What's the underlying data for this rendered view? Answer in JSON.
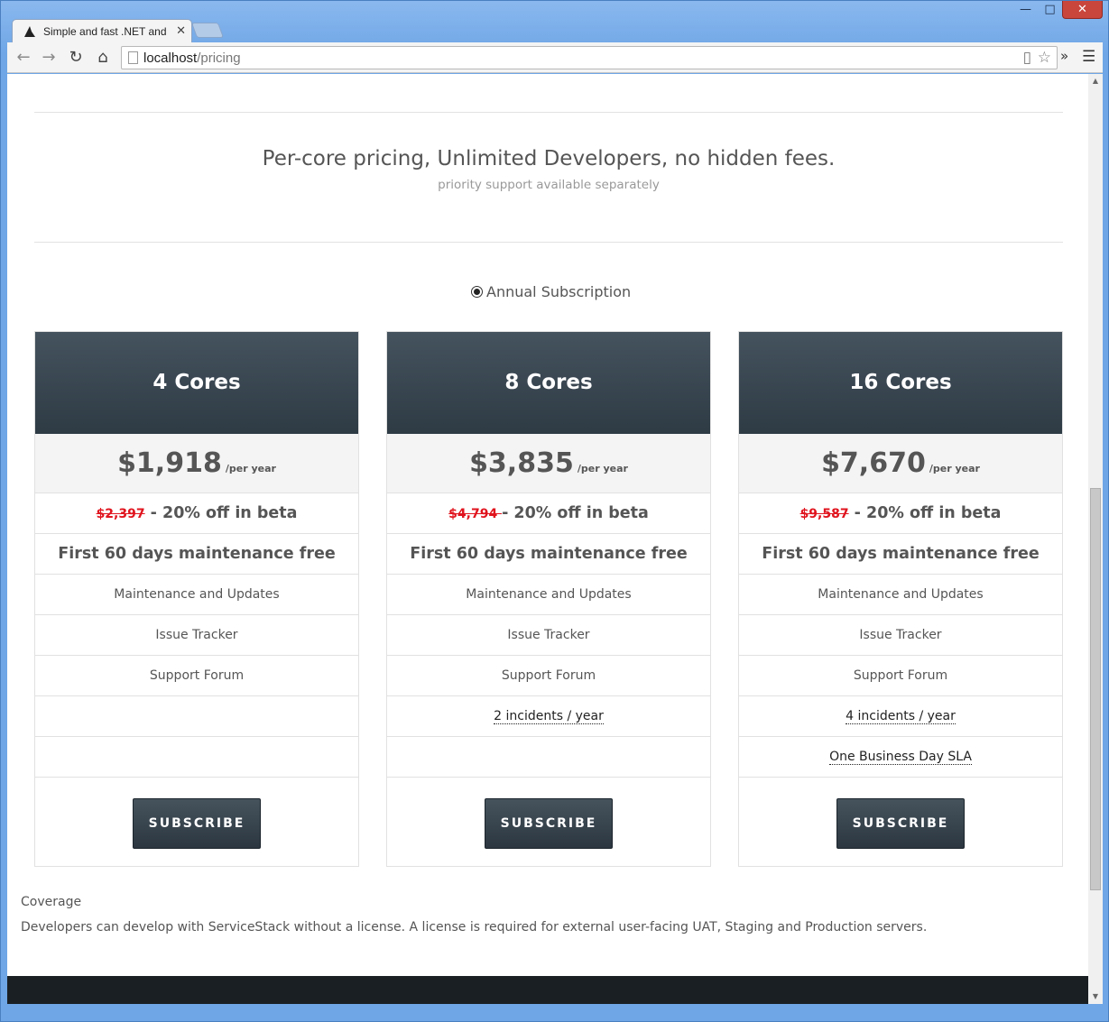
{
  "browser": {
    "tab_title": "Simple and fast .NET and",
    "url_host": "localhost",
    "url_path": "/pricing"
  },
  "page": {
    "headline": "Per-core pricing, Unlimited Developers, no hidden fees.",
    "subhead": "priority support available separately",
    "plan_option": "Annual Subscription",
    "coverage_title": "Coverage",
    "coverage_text": "Developers can develop with ServiceStack without a license. A license is required for external user-facing UAT, Staging and Production servers."
  },
  "plans": [
    {
      "name": "4 Cores",
      "price": "$1,918",
      "unit": "/per year",
      "old_price": "$2,397",
      "discount": " - 20% off in beta",
      "promo": "First 60 days maintenance free",
      "features": [
        "Maintenance and Updates",
        "Issue Tracker",
        "Support Forum"
      ],
      "incidents": "",
      "sla": "",
      "button": "SUBSCRIBE"
    },
    {
      "name": "8 Cores",
      "price": "$3,835",
      "unit": "/per year",
      "old_price": "$4,794 ",
      "discount": "- 20% off in beta",
      "promo": "First 60 days maintenance free",
      "features": [
        "Maintenance and Updates",
        "Issue Tracker",
        "Support Forum"
      ],
      "incidents": "2 incidents / year",
      "sla": "",
      "button": "SUBSCRIBE"
    },
    {
      "name": "16 Cores",
      "price": "$7,670",
      "unit": "/per year",
      "old_price": "$9,587",
      "discount": " - 20% off in beta",
      "promo": "First 60 days maintenance free",
      "features": [
        "Maintenance and Updates",
        "Issue Tracker",
        "Support Forum"
      ],
      "incidents": "4 incidents / year",
      "sla": "One Business Day SLA",
      "button": "SUBSCRIBE"
    }
  ],
  "colors": {
    "card_header": "#36434d",
    "strike_price": "#e0141e",
    "footer": "#1a1f24"
  }
}
